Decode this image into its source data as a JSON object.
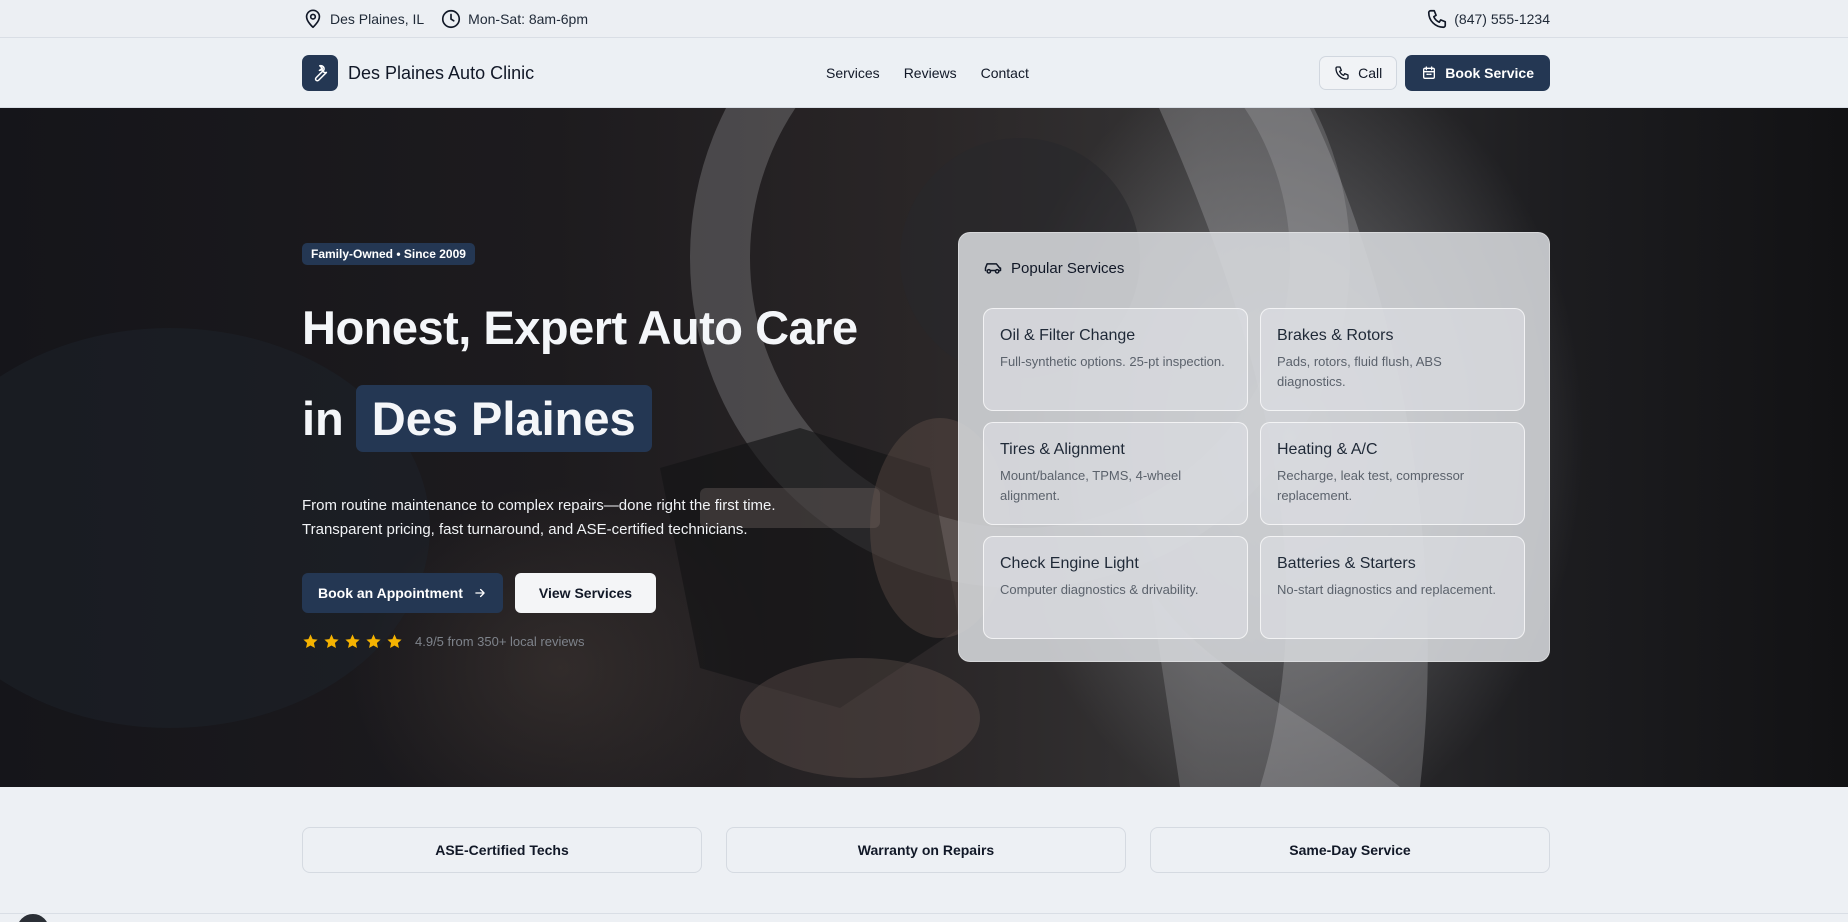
{
  "topbar": {
    "location": "Des Plaines, IL",
    "hours": "Mon-Sat: 8am-6pm",
    "phone": "(847) 555-1234"
  },
  "nav": {
    "brand": "Des Plaines Auto Clinic",
    "links": [
      "Services",
      "Reviews",
      "Contact"
    ],
    "call_label": "Call",
    "book_label": "Book Service"
  },
  "hero": {
    "badge": "Family-Owned • Since 2009",
    "title_line1": "Honest, Expert Auto Care",
    "title_in": "in",
    "title_highlight": "Des Plaines",
    "subtitle_line1": "From routine maintenance to complex repairs—done right the first time.",
    "subtitle_line2": "Transparent pricing, fast turnaround, and ASE-certified technicians.",
    "cta_primary": "Book an Appointment",
    "cta_secondary": "View Services",
    "rating_stars": 5,
    "rating_text": "4.9/5 from 350+ local reviews"
  },
  "services_card": {
    "title": "Popular Services",
    "items": [
      {
        "name": "Oil & Filter Change",
        "desc": "Full-synthetic options. 25-pt inspection."
      },
      {
        "name": "Brakes & Rotors",
        "desc": "Pads, rotors, fluid flush, ABS diagnostics."
      },
      {
        "name": "Tires & Alignment",
        "desc": "Mount/balance, TPMS, 4-wheel alignment."
      },
      {
        "name": "Heating & A/C",
        "desc": "Recharge, leak test, compressor replacement."
      },
      {
        "name": "Check Engine Light",
        "desc": "Computer diagnostics & drivability."
      },
      {
        "name": "Batteries & Starters",
        "desc": "No-start diagnostics and replacement."
      }
    ]
  },
  "features": [
    "ASE-Certified Techs",
    "Warranty on Repairs",
    "Same-Day Service"
  ],
  "colors": {
    "brand": "#243753",
    "star": "#f5b301",
    "page_bg": "#edf0f4"
  },
  "icons": {
    "location": "map-pin-icon",
    "hours": "clock-icon",
    "phone": "phone-icon",
    "logo": "wrench-icon",
    "book": "calendar-icon",
    "arrow": "arrow-right-icon",
    "card": "car-icon",
    "star": "star-icon"
  }
}
